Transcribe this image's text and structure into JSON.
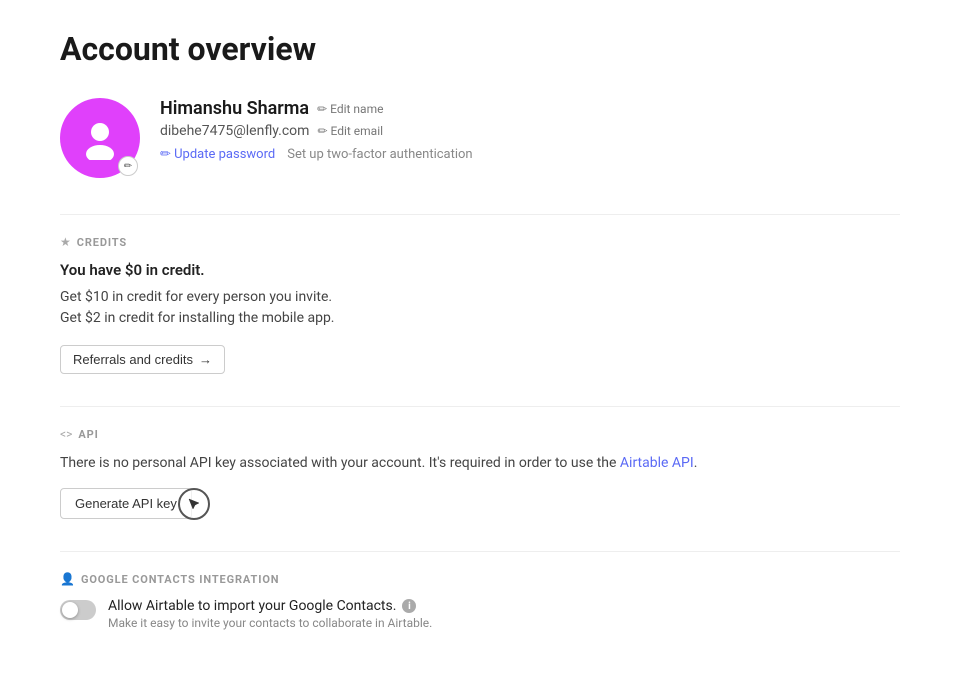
{
  "page": {
    "title": "Account overview"
  },
  "profile": {
    "name": "Himanshu Sharma",
    "email": "dibehe7475@lenfly.com",
    "edit_name_label": "✏ Edit name",
    "edit_email_label": "✏ Edit email",
    "update_password_label": "✏ Update password",
    "two_factor_label": "Set up two-factor authentication"
  },
  "credits_section": {
    "icon": "★",
    "title": "CREDITS",
    "balance_text": "You have $0 in credit.",
    "invite_info": "Get $10 in credit for every person you invite.",
    "app_info": "Get $2 in credit for installing the mobile app.",
    "referrals_button": "Referrals and credits",
    "referrals_arrow": "→"
  },
  "api_section": {
    "icon": "<>",
    "title": "API",
    "description_before": "There is no personal API key associated with your account. It's required in order to use the ",
    "api_link_text": "Airtable API",
    "description_after": ".",
    "generate_button": "Generate API key"
  },
  "google_section": {
    "icon": "👤",
    "title": "GOOGLE CONTACTS INTEGRATION",
    "allow_label": "Allow Airtable to import your Google Contacts.",
    "sub_label": "Make it easy to invite your contacts to collaborate in Airtable."
  }
}
